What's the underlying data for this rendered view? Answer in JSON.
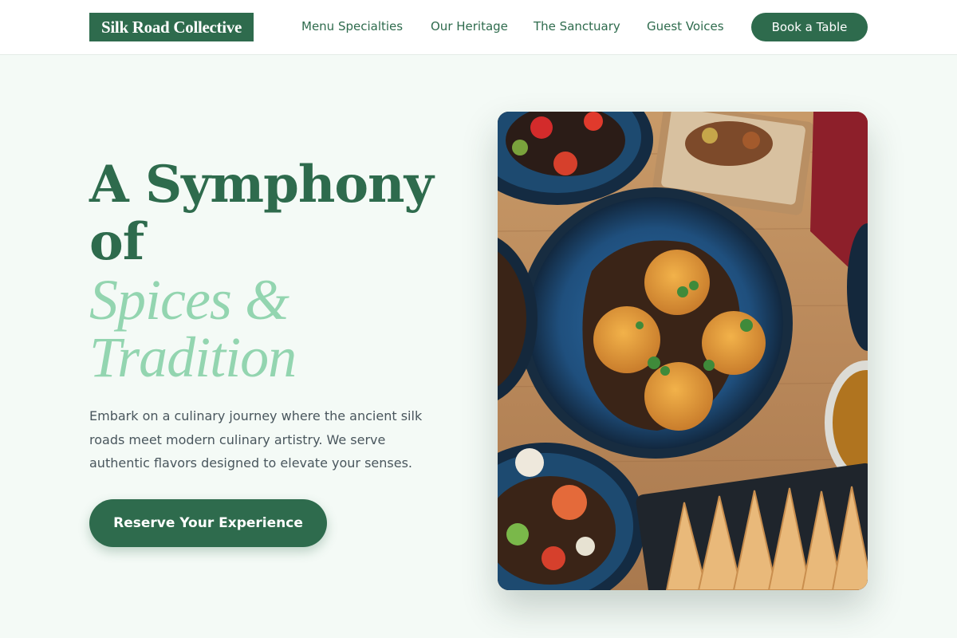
{
  "header": {
    "logo": "Silk Road Collective",
    "nav": [
      "Menu Specialties",
      "Our Heritage",
      "The Sanctuary",
      "Guest Voices"
    ],
    "cta": "Book a Table"
  },
  "hero": {
    "title_lines": [
      "A Symphony",
      "of"
    ],
    "accent_lines": [
      "Spices &",
      "Tradition"
    ],
    "description": "Embark on a culinary journey where the ancient silk roads meet modern culinary artistry. We serve authentic flavors designed to elevate your senses.",
    "cta": "Reserve Your Experience"
  },
  "image": {
    "subject": "overhead photo of Asian dishes on a wooden table"
  },
  "colors": {
    "brand": "#2e6b4d",
    "accent": "#93d5b0",
    "background": "#f4faf6",
    "body_text": "#49565d"
  }
}
